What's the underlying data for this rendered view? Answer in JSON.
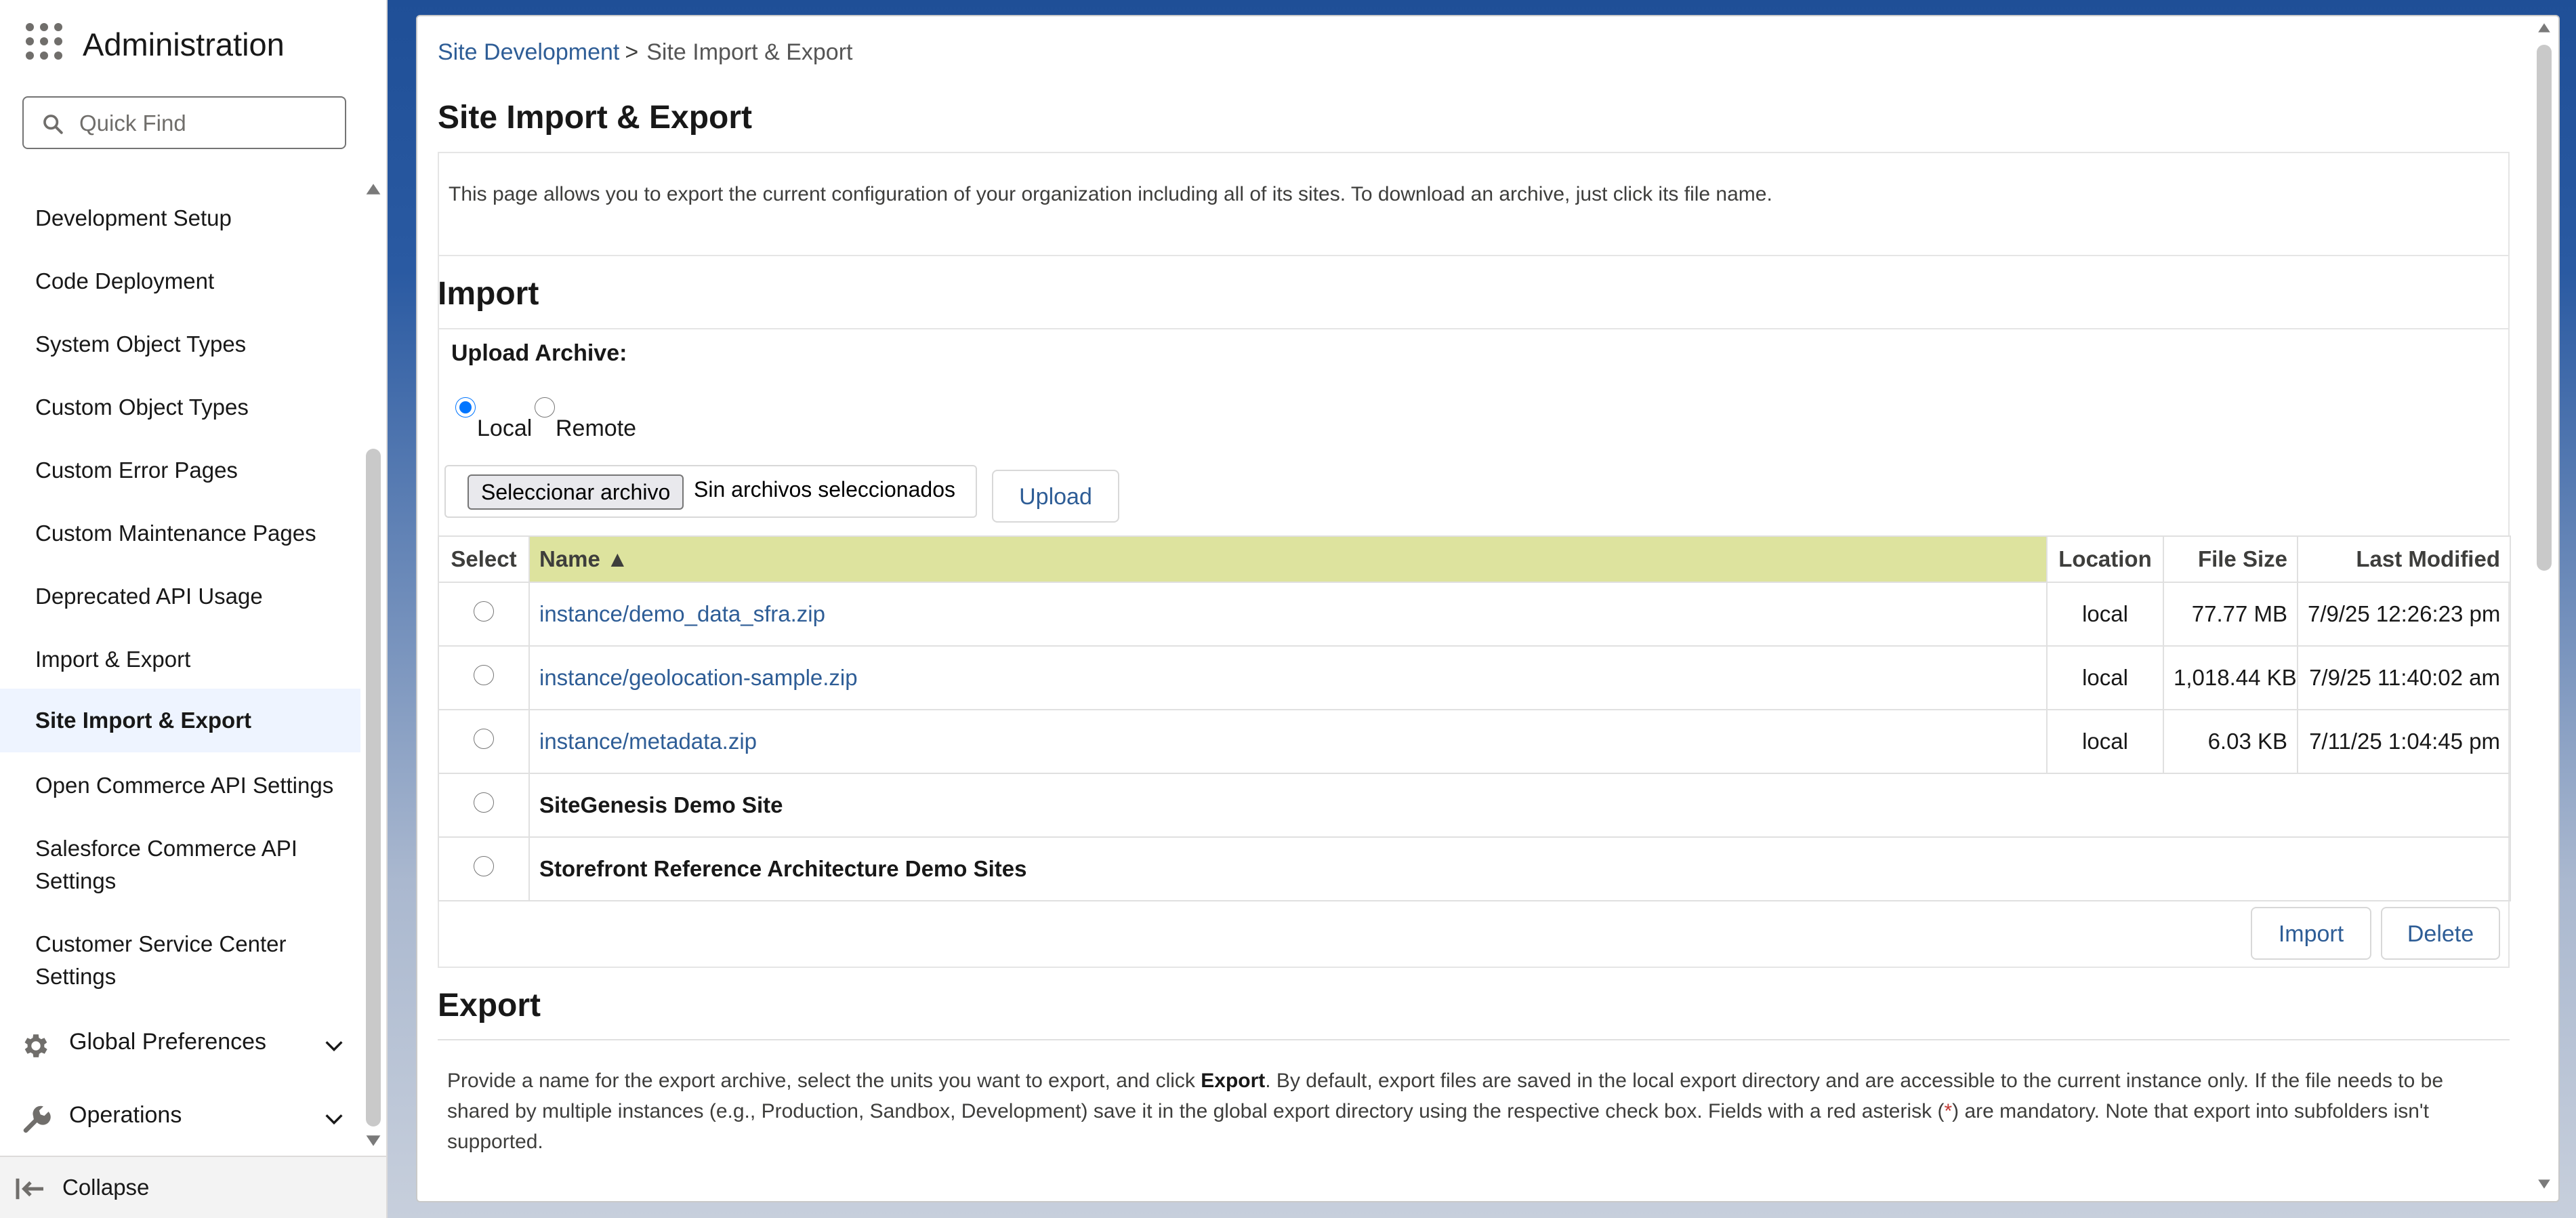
{
  "sidebar": {
    "title": "Administration",
    "search_placeholder": "Quick Find",
    "items": [
      {
        "label": "Development Setup"
      },
      {
        "label": "Code Deployment"
      },
      {
        "label": "System Object Types"
      },
      {
        "label": "Custom Object Types"
      },
      {
        "label": "Custom Error Pages"
      },
      {
        "label": "Custom Maintenance Pages"
      },
      {
        "label": "Deprecated API Usage"
      },
      {
        "label": "Import & Export"
      },
      {
        "label": "Site Import & Export",
        "active": true
      },
      {
        "label": "Open Commerce API Settings"
      },
      {
        "label": "Salesforce Commerce API Settings"
      },
      {
        "label": "Customer Service Center Settings"
      }
    ],
    "groups": [
      {
        "label": "Global Preferences",
        "icon": "gear-icon"
      },
      {
        "label": "Operations",
        "icon": "wrench-icon"
      }
    ],
    "collapse_label": "Collapse"
  },
  "breadcrumb": {
    "parent": "Site Development",
    "separator": ">",
    "current": "Site Import & Export"
  },
  "page_title": "Site Import & Export",
  "intro_text": "This page allows you to export the current configuration of your organization including all of its sites. To download an archive, just click its file name.",
  "import": {
    "title": "Import",
    "upload_label": "Upload Archive:",
    "radio_local": "Local",
    "radio_remote": "Remote",
    "selected_source": "Local",
    "file_button": "Seleccionar archivo",
    "file_status": "Sin archivos seleccionados",
    "upload_button": "Upload",
    "table": {
      "columns": [
        "Select",
        "Name ▲",
        "Location",
        "File Size",
        "Last Modified"
      ],
      "sorted_column": "Name",
      "rows": [
        {
          "name": "instance/demo_data_sfra.zip",
          "location": "local",
          "size": "77.77 MB",
          "modified": "7/9/25 12:26:23 pm"
        },
        {
          "name": "instance/geolocation-sample.zip",
          "location": "local",
          "size": "1,018.44 KB",
          "modified": "7/9/25 11:40:02 am"
        },
        {
          "name": "instance/metadata.zip",
          "location": "local",
          "size": "6.03 KB",
          "modified": "7/11/25 1:04:45 pm"
        }
      ],
      "sites": [
        {
          "name": "SiteGenesis Demo Site"
        },
        {
          "name": "Storefront Reference Architecture Demo Sites"
        }
      ]
    },
    "import_button": "Import",
    "delete_button": "Delete"
  },
  "export": {
    "title": "Export",
    "text_1": "Provide a name for the export archive, select the units you want to export, and click ",
    "text_bold": "Export",
    "text_2": ". By default, export files are saved in the local export directory and are accessible to the current instance only. If the file needs to be shared by multiple instances (e.g., Production, Sandbox, Development) save it in the global export directory using the respective check box. Fields with a red asterisk (",
    "asterisk": "*",
    "text_3": ") are mandatory. Note that export into subfolders isn't supported."
  },
  "colors": {
    "link": "#2e5d96",
    "sorted_header": "#dde39e",
    "active_nav_bg": "#eef4ff",
    "header_gradient_top": "#1f4f97"
  }
}
